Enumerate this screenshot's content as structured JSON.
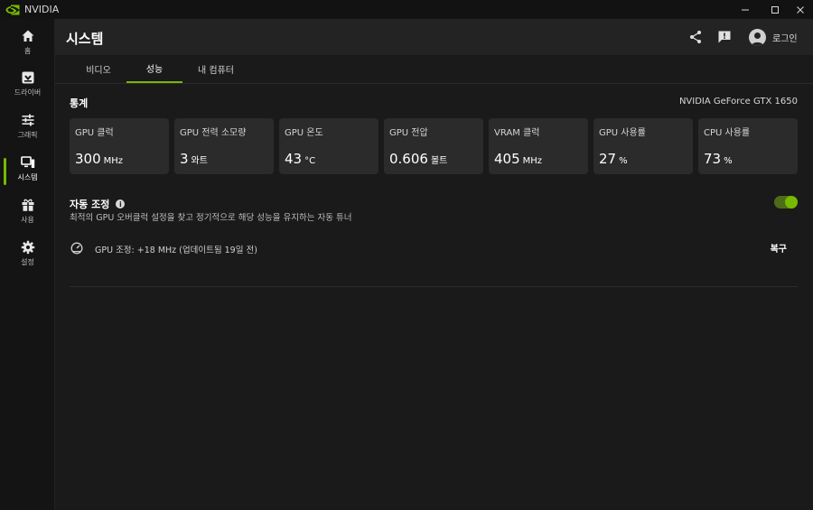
{
  "window": {
    "title": "NVIDIA",
    "brand_color": "#76b900"
  },
  "sidebar": {
    "items": [
      {
        "label": "홈",
        "icon": "home-icon"
      },
      {
        "label": "드라이버",
        "icon": "driver-icon"
      },
      {
        "label": "그래픽",
        "icon": "graphics-sliders-icon"
      },
      {
        "label": "시스템",
        "icon": "system-icon",
        "active": true
      },
      {
        "label": "사용",
        "icon": "gift-icon"
      },
      {
        "label": "설정",
        "icon": "gear-icon"
      }
    ]
  },
  "header": {
    "title": "시스템",
    "login_label": "로그인"
  },
  "tabs": [
    {
      "label": "비디오"
    },
    {
      "label": "성능",
      "active": true
    },
    {
      "label": "내 컴퓨터"
    }
  ],
  "stats": {
    "title": "통계",
    "gpu_name": "NVIDIA GeForce GTX 1650",
    "cards": [
      {
        "name": "GPU 클럭",
        "value": "300",
        "unit": "MHz"
      },
      {
        "name": "GPU 전력 소모량",
        "value": "3",
        "unit": "와트"
      },
      {
        "name": "GPU 온도",
        "value": "43",
        "unit": "°C"
      },
      {
        "name": "GPU 전압",
        "value": "0.606",
        "unit": "볼트"
      },
      {
        "name": "VRAM 클럭",
        "value": "405",
        "unit": "MHz"
      },
      {
        "name": "GPU 사용률",
        "value": "27",
        "unit": "%"
      },
      {
        "name": "CPU 사용률",
        "value": "73",
        "unit": "%"
      }
    ]
  },
  "auto_tune": {
    "title": "자동 조정",
    "description": "최적의 GPU 오버클럭 설정을 찾고 정기적으로 해당 성능을 유지하는 자동 튜너",
    "enabled": true,
    "gpu_tune_text": "GPU 조정: +18 MHz (업데이트됨 19일 전)",
    "restore_label": "복구"
  }
}
